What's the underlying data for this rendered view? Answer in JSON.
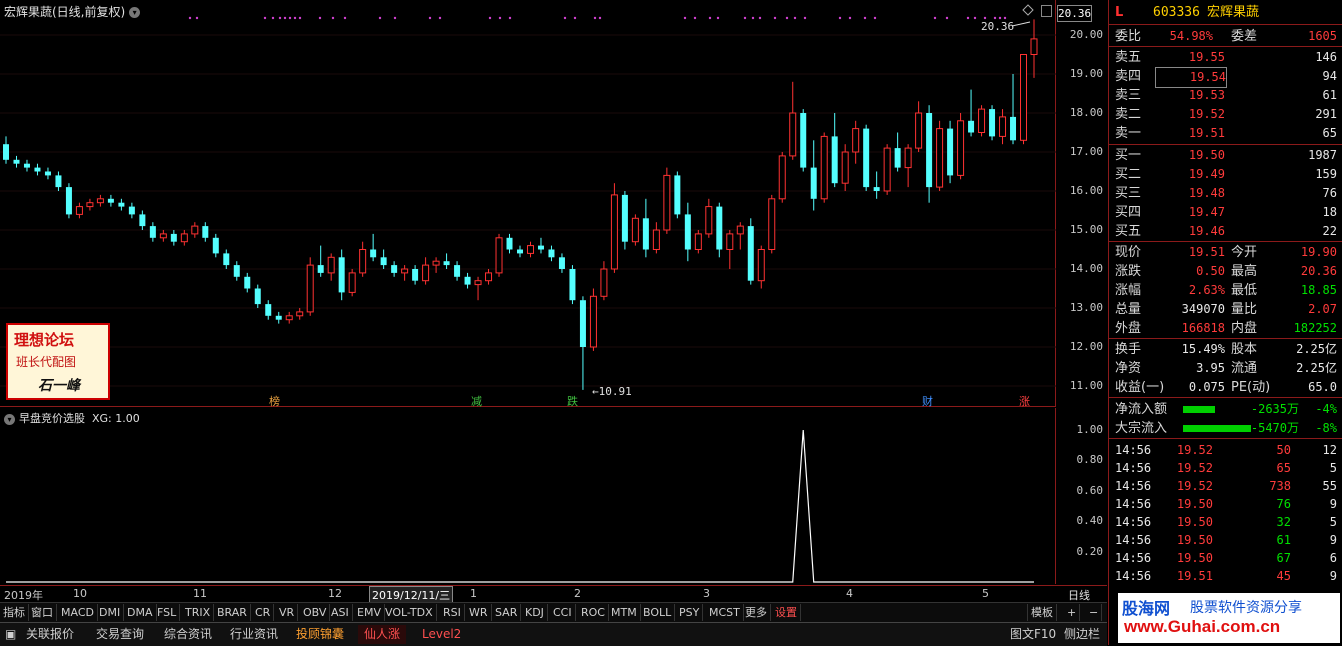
{
  "main_chart": {
    "title": "宏辉果蔬(日线,前复权)",
    "price_ticks": [
      "20.00",
      "19.00",
      "18.00",
      "17.00",
      "16.00",
      "15.00",
      "14.00",
      "13.00",
      "12.00",
      "11.00"
    ],
    "current_price_label": "20.36",
    "high_marker": "20.36",
    "low_marker": "10.91",
    "event_markers": [
      {
        "text": "榜",
        "color": "#e8a040"
      },
      {
        "text": "减",
        "color": "#40c040"
      },
      {
        "text": "跌",
        "color": "#40c040"
      },
      {
        "text": "财",
        "color": "#4090ff"
      },
      {
        "text": "涨",
        "color": "#ff4040"
      }
    ],
    "candles": [
      [
        17.2,
        17.4,
        16.7,
        16.8
      ],
      [
        16.8,
        16.9,
        16.6,
        16.7
      ],
      [
        16.7,
        16.8,
        16.5,
        16.6
      ],
      [
        16.6,
        16.7,
        16.4,
        16.5
      ],
      [
        16.5,
        16.6,
        16.3,
        16.4
      ],
      [
        16.4,
        16.5,
        16.0,
        16.1
      ],
      [
        16.1,
        16.2,
        15.3,
        15.4
      ],
      [
        15.4,
        15.7,
        15.3,
        15.6
      ],
      [
        15.6,
        15.8,
        15.5,
        15.7
      ],
      [
        15.7,
        15.9,
        15.6,
        15.8
      ],
      [
        15.8,
        15.9,
        15.6,
        15.7
      ],
      [
        15.7,
        15.8,
        15.5,
        15.6
      ],
      [
        15.6,
        15.7,
        15.3,
        15.4
      ],
      [
        15.4,
        15.5,
        15.0,
        15.1
      ],
      [
        15.1,
        15.2,
        14.7,
        14.8
      ],
      [
        14.8,
        15.0,
        14.7,
        14.9
      ],
      [
        14.9,
        15.0,
        14.6,
        14.7
      ],
      [
        14.7,
        15.0,
        14.6,
        14.9
      ],
      [
        14.9,
        15.2,
        14.8,
        15.1
      ],
      [
        15.1,
        15.2,
        14.7,
        14.8
      ],
      [
        14.8,
        14.9,
        14.3,
        14.4
      ],
      [
        14.4,
        14.5,
        14.0,
        14.1
      ],
      [
        14.1,
        14.2,
        13.7,
        13.8
      ],
      [
        13.8,
        13.9,
        13.4,
        13.5
      ],
      [
        13.5,
        13.6,
        13.0,
        13.1
      ],
      [
        13.1,
        13.2,
        12.7,
        12.8
      ],
      [
        12.8,
        12.9,
        12.6,
        12.7
      ],
      [
        12.7,
        12.9,
        12.6,
        12.8
      ],
      [
        12.8,
        13.0,
        12.7,
        12.9
      ],
      [
        12.9,
        14.3,
        12.8,
        14.1
      ],
      [
        14.1,
        14.6,
        13.8,
        13.9
      ],
      [
        13.9,
        14.4,
        13.7,
        14.3
      ],
      [
        14.3,
        14.5,
        13.2,
        13.4
      ],
      [
        13.4,
        14.0,
        13.3,
        13.9
      ],
      [
        13.9,
        14.7,
        13.8,
        14.5
      ],
      [
        14.5,
        14.9,
        14.2,
        14.3
      ],
      [
        14.3,
        14.5,
        14.0,
        14.1
      ],
      [
        14.1,
        14.2,
        13.8,
        13.9
      ],
      [
        13.9,
        14.1,
        13.7,
        14.0
      ],
      [
        14.0,
        14.1,
        13.6,
        13.7
      ],
      [
        13.7,
        14.3,
        13.6,
        14.1
      ],
      [
        14.1,
        14.3,
        13.9,
        14.2
      ],
      [
        14.2,
        14.4,
        14.0,
        14.1
      ],
      [
        14.1,
        14.2,
        13.7,
        13.8
      ],
      [
        13.8,
        13.9,
        13.5,
        13.6
      ],
      [
        13.6,
        13.8,
        13.2,
        13.7
      ],
      [
        13.7,
        14.0,
        13.6,
        13.9
      ],
      [
        13.9,
        14.9,
        13.8,
        14.8
      ],
      [
        14.8,
        14.9,
        14.4,
        14.5
      ],
      [
        14.5,
        14.6,
        14.3,
        14.4
      ],
      [
        14.4,
        14.7,
        14.3,
        14.6
      ],
      [
        14.6,
        14.8,
        14.4,
        14.5
      ],
      [
        14.5,
        14.6,
        14.2,
        14.3
      ],
      [
        14.3,
        14.4,
        13.9,
        14.0
      ],
      [
        14.0,
        14.1,
        13.1,
        13.2
      ],
      [
        13.2,
        13.3,
        10.9,
        12.0
      ],
      [
        12.0,
        13.5,
        11.9,
        13.3
      ],
      [
        13.3,
        14.2,
        13.2,
        14.0
      ],
      [
        14.0,
        16.2,
        13.9,
        15.9
      ],
      [
        15.9,
        16.0,
        14.5,
        14.7
      ],
      [
        14.7,
        15.4,
        14.6,
        15.3
      ],
      [
        15.3,
        15.8,
        14.3,
        14.5
      ],
      [
        14.5,
        15.2,
        14.4,
        15.0
      ],
      [
        15.0,
        16.6,
        14.9,
        16.4
      ],
      [
        16.4,
        16.5,
        15.3,
        15.4
      ],
      [
        15.4,
        15.7,
        14.2,
        14.5
      ],
      [
        14.5,
        15.0,
        14.4,
        14.9
      ],
      [
        14.9,
        15.8,
        14.8,
        15.6
      ],
      [
        15.6,
        15.7,
        14.3,
        14.5
      ],
      [
        14.5,
        15.0,
        14.0,
        14.9
      ],
      [
        14.9,
        15.2,
        14.5,
        15.1
      ],
      [
        15.1,
        15.3,
        13.6,
        13.7
      ],
      [
        13.7,
        14.6,
        13.5,
        14.5
      ],
      [
        14.5,
        15.9,
        14.4,
        15.8
      ],
      [
        15.8,
        17.0,
        15.7,
        16.9
      ],
      [
        16.9,
        18.8,
        16.8,
        18.0
      ],
      [
        18.0,
        18.1,
        16.5,
        16.6
      ],
      [
        16.6,
        17.3,
        15.5,
        15.8
      ],
      [
        15.8,
        17.5,
        15.7,
        17.4
      ],
      [
        17.4,
        18.0,
        16.1,
        16.2
      ],
      [
        16.2,
        17.2,
        16.0,
        17.0
      ],
      [
        17.0,
        17.8,
        16.7,
        17.6
      ],
      [
        17.6,
        17.7,
        16.0,
        16.1
      ],
      [
        16.1,
        16.5,
        15.8,
        16.0
      ],
      [
        16.0,
        17.2,
        15.9,
        17.1
      ],
      [
        17.1,
        17.5,
        16.5,
        16.6
      ],
      [
        16.6,
        17.2,
        16.1,
        17.1
      ],
      [
        17.1,
        18.3,
        17.0,
        18.0
      ],
      [
        18.0,
        18.2,
        15.7,
        16.1
      ],
      [
        16.1,
        17.8,
        16.0,
        17.6
      ],
      [
        17.6,
        17.8,
        16.2,
        16.4
      ],
      [
        16.4,
        18.0,
        16.3,
        17.8
      ],
      [
        17.8,
        18.6,
        17.4,
        17.5
      ],
      [
        17.5,
        18.2,
        17.4,
        18.1
      ],
      [
        18.1,
        18.2,
        17.3,
        17.4
      ],
      [
        17.4,
        18.1,
        17.2,
        17.9
      ],
      [
        17.9,
        19.0,
        17.2,
        17.3
      ],
      [
        17.3,
        19.5,
        17.2,
        19.5
      ],
      [
        19.5,
        20.4,
        18.9,
        19.9
      ]
    ]
  },
  "indicator": {
    "title": "早盘竞价选股",
    "xg_label": "XG: 1.00",
    "ticks": [
      "1.00",
      "0.80",
      "0.60",
      "0.40",
      "0.20"
    ],
    "signals": [
      {
        "index": 76,
        "value": 1.0
      },
      {
        "index": 99,
        "value": 1.0
      }
    ]
  },
  "date_axis": {
    "labels": [
      "2019年",
      "10",
      "11",
      "12",
      "1",
      "2",
      "3",
      "4",
      "5"
    ],
    "cursor": "2019/12/11/三",
    "period": "日线"
  },
  "ind_toolbar": [
    "指标",
    "窗口",
    "MACD",
    "DMI",
    "DMA",
    "FSL",
    "TRIX",
    "BRAR",
    "CR",
    "VR",
    "OBV",
    "ASI",
    "EMV",
    "VOL-TDX",
    "RSI",
    "WR",
    "SAR",
    "KDJ",
    "CCI",
    "ROC",
    "MTM",
    "BOLL",
    "PSY",
    "MCST",
    "更多",
    "设置"
  ],
  "toolbar_right": {
    "template": "模板",
    "plus": "+",
    "minus": "−"
  },
  "bottom_bar": [
    "关联报价",
    "交易查询",
    "综合资讯",
    "行业资讯",
    "投顾锦囊",
    "仙人涨",
    "Level2"
  ],
  "bottom_right": {
    "f10": "图文F10",
    "sidebar": "侧边栏"
  },
  "watermark": {
    "line1": "理想论坛",
    "line2": "班长代配图",
    "line3": "石一峰"
  },
  "quote": {
    "marker": "L",
    "code": "603336",
    "name": "宏辉果蔬",
    "weibi_label": "委比",
    "weibi": "54.98%",
    "weicha_label": "委差",
    "weicha": "1605",
    "asks": [
      {
        "label": "卖五",
        "price": "19.55",
        "vol": "146"
      },
      {
        "label": "卖四",
        "price": "19.54",
        "vol": "94"
      },
      {
        "label": "卖三",
        "price": "19.53",
        "vol": "61"
      },
      {
        "label": "卖二",
        "price": "19.52",
        "vol": "291"
      },
      {
        "label": "卖一",
        "price": "19.51",
        "vol": "65"
      }
    ],
    "bids": [
      {
        "label": "买一",
        "price": "19.50",
        "vol": "1987"
      },
      {
        "label": "买二",
        "price": "19.49",
        "vol": "159"
      },
      {
        "label": "买三",
        "price": "19.48",
        "vol": "76"
      },
      {
        "label": "买四",
        "price": "19.47",
        "vol": "18"
      },
      {
        "label": "买五",
        "price": "19.46",
        "vol": "22"
      }
    ],
    "stats": [
      {
        "l1": "现价",
        "v1": "19.51",
        "c1": "red",
        "l2": "今开",
        "v2": "19.90",
        "c2": "red"
      },
      {
        "l1": "涨跌",
        "v1": "0.50",
        "c1": "red",
        "l2": "最高",
        "v2": "20.36",
        "c2": "red"
      },
      {
        "l1": "涨幅",
        "v1": "2.63%",
        "c1": "red",
        "l2": "最低",
        "v2": "18.85",
        "c2": "green"
      },
      {
        "l1": "总量",
        "v1": "349070",
        "c1": "white",
        "l2": "量比",
        "v2": "2.07",
        "c2": "red"
      },
      {
        "l1": "外盘",
        "v1": "166818",
        "c1": "red",
        "l2": "内盘",
        "v2": "182252",
        "c2": "green"
      }
    ],
    "stats2": [
      {
        "l1": "换手",
        "v1": "15.49%",
        "l2": "股本",
        "v2": "2.25亿"
      },
      {
        "l1": "净资",
        "v1": "3.95",
        "l2": "流通",
        "v2": "2.25亿"
      },
      {
        "l1": "收益(一)",
        "v1": "0.075",
        "l2": "PE(动)",
        "v2": "65.0"
      }
    ],
    "flows": [
      {
        "label": "净流入额",
        "value": "-2635万",
        "pct": "-4%",
        "bar": 0.4
      },
      {
        "label": "大宗流入",
        "value": "-5470万",
        "pct": "-8%",
        "bar": 0.85
      }
    ],
    "ticks": [
      {
        "time": "14:56",
        "price": "19.52",
        "vol": "50",
        "vc": "red",
        "n": "12"
      },
      {
        "time": "14:56",
        "price": "19.52",
        "vol": "65",
        "vc": "red",
        "n": "5"
      },
      {
        "time": "14:56",
        "price": "19.52",
        "vol": "738",
        "vc": "red",
        "n": "55"
      },
      {
        "time": "14:56",
        "price": "19.50",
        "vol": "76",
        "vc": "green",
        "n": "9"
      },
      {
        "time": "14:56",
        "price": "19.50",
        "vol": "32",
        "vc": "green",
        "n": "5"
      },
      {
        "time": "14:56",
        "price": "19.50",
        "vol": "61",
        "vc": "green",
        "n": "9"
      },
      {
        "time": "14:56",
        "price": "19.50",
        "vol": "67",
        "vc": "green",
        "n": "6"
      },
      {
        "time": "14:56",
        "price": "19.51",
        "vol": "45",
        "vc": "red",
        "n": "9"
      }
    ]
  },
  "guhai": {
    "line1": "股海网",
    "line2": "股票软件资源分享",
    "line3": "www.Guhai.com.cn"
  }
}
